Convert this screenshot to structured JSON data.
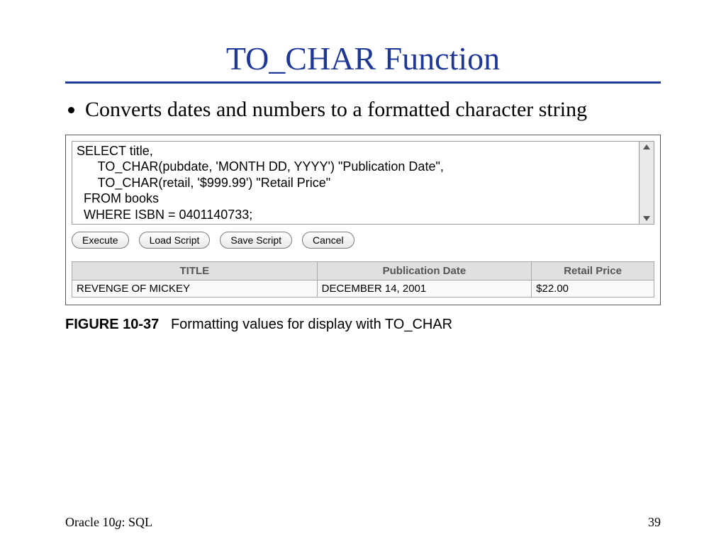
{
  "title": "TO_CHAR Function",
  "bullet": "Converts dates and numbers to a formatted character string",
  "sql_code": "SELECT title,\n      TO_CHAR(pubdate, 'MONTH DD, YYYY') \"Publication Date\",\n      TO_CHAR(retail, '$999.99') \"Retail Price\"\n  FROM books\n  WHERE ISBN = 0401140733;",
  "buttons": {
    "execute": "Execute",
    "load": "Load Script",
    "save": "Save Script",
    "cancel": "Cancel"
  },
  "table": {
    "headers": [
      "TITLE",
      "Publication Date",
      "Retail Price"
    ],
    "rows": [
      [
        "REVENGE OF MICKEY",
        "DECEMBER  14, 2001",
        "$22.00"
      ]
    ]
  },
  "figure": {
    "label": "FIGURE 10-37",
    "caption": "Formatting values for display with TO_CHAR"
  },
  "footer": {
    "product": "Oracle 10",
    "product_italic": "g",
    "product_suffix": ": SQL",
    "page": "39"
  }
}
